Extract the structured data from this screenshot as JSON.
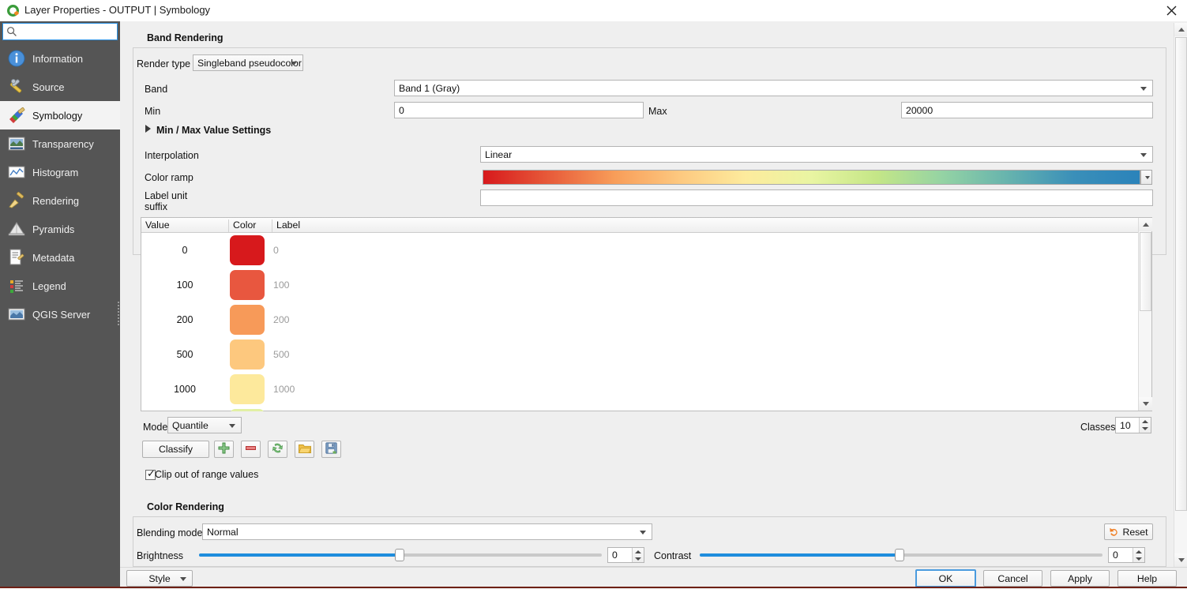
{
  "window": {
    "title": "Layer Properties - OUTPUT | Symbology",
    "app_icon": "qgis-logo-icon",
    "close_icon": "close-icon"
  },
  "sidebar": {
    "search": {
      "placeholder": "",
      "value": "",
      "icon": "search-icon"
    },
    "items": [
      {
        "label": "Information",
        "icon": "information-icon",
        "selected": false
      },
      {
        "label": "Source",
        "icon": "source-icon",
        "selected": false
      },
      {
        "label": "Symbology",
        "icon": "symbology-brush-icon",
        "selected": true
      },
      {
        "label": "Transparency",
        "icon": "transparency-icon",
        "selected": false
      },
      {
        "label": "Histogram",
        "icon": "histogram-icon",
        "selected": false
      },
      {
        "label": "Rendering",
        "icon": "rendering-brush-icon",
        "selected": false
      },
      {
        "label": "Pyramids",
        "icon": "pyramids-icon",
        "selected": false
      },
      {
        "label": "Metadata",
        "icon": "metadata-icon",
        "selected": false
      },
      {
        "label": "Legend",
        "icon": "legend-icon",
        "selected": false
      },
      {
        "label": "QGIS Server",
        "icon": "qgis-server-icon",
        "selected": false
      }
    ]
  },
  "band_rendering": {
    "section_title": "Band Rendering",
    "render_type_label": "Render type",
    "render_type_value": "Singleband pseudocolor",
    "band_label": "Band",
    "band_value": "Band 1 (Gray)",
    "min_label": "Min",
    "min_value": "0",
    "max_label": "Max",
    "max_value": "20000",
    "minmax_settings_title": "Min / Max Value Settings",
    "interpolation_label": "Interpolation",
    "interpolation_value": "Linear",
    "color_ramp_label": "Color ramp",
    "label_unit_suffix_label_line1": "Label unit",
    "label_unit_suffix_label_line2": "suffix",
    "label_unit_suffix_value": "",
    "color_ramp_stops": [
      "#d7191c",
      "#e75b3a",
      "#f89d59",
      "#fdc980",
      "#fdeb9d",
      "#e9f5a2",
      "#c4e687",
      "#94d3a4",
      "#66b3ae",
      "#3a8fb9",
      "#2b83ba"
    ]
  },
  "class_table": {
    "columns": [
      "Value",
      "Color",
      "Label"
    ],
    "rows": [
      {
        "value": "0",
        "color": "#d7191c",
        "label": "0"
      },
      {
        "value": "100",
        "color": "#e8573f",
        "label": "100"
      },
      {
        "value": "200",
        "color": "#f79a59",
        "label": "200"
      },
      {
        "value": "500",
        "color": "#fdc87e",
        "label": "500"
      },
      {
        "value": "1000",
        "color": "#fde99c",
        "label": "1000"
      },
      {
        "value": "",
        "color": "#e2f0a4",
        "label": ""
      }
    ]
  },
  "classify_bar": {
    "mode_label": "Mode",
    "mode_value": "Quantile",
    "classify_label": "Classify",
    "add_icon": "add-plus-icon",
    "remove_icon": "remove-minus-icon",
    "sort_icon": "flip-arrows-icon",
    "load_icon": "folder-open-icon",
    "save_icon": "save-disk-icon",
    "classes_label": "Classes",
    "classes_value": "10",
    "clip_label": "Clip out of range values",
    "clip_checked": true
  },
  "color_rendering": {
    "section_title": "Color Rendering",
    "blending_mode_label": "Blending mode",
    "blending_mode_value": "Normal",
    "brightness_label": "Brightness",
    "brightness_value": "0",
    "contrast_label": "Contrast",
    "contrast_value": "0",
    "reset_label": "Reset",
    "reset_icon": "undo-arrow-icon"
  },
  "footer": {
    "style_label": "Style",
    "ok_label": "OK",
    "cancel_label": "Cancel",
    "apply_label": "Apply",
    "help_label": "Help"
  },
  "colors": {
    "accent": "#1f8ddd",
    "sidebar_bg": "#555555",
    "panel_bg": "#efefef",
    "focus_border": "#2c92e4"
  }
}
